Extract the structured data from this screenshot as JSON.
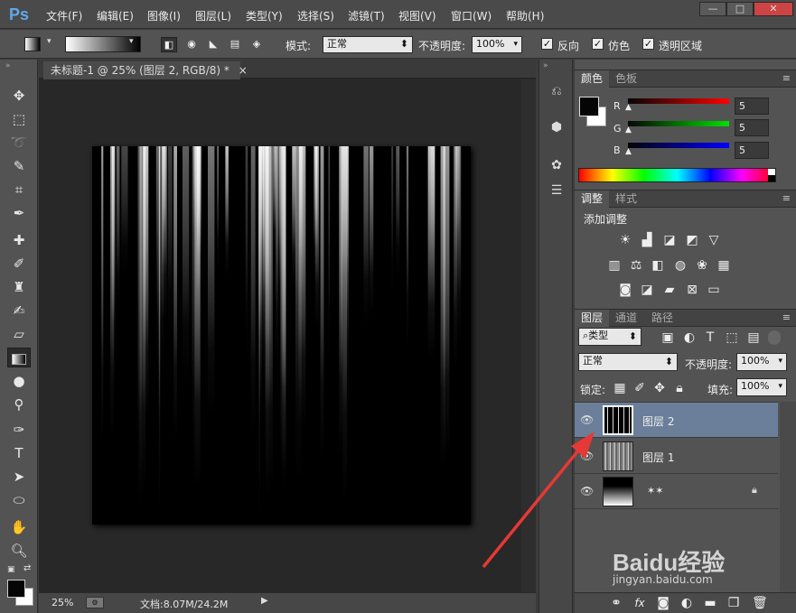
{
  "app": {
    "logo": "Ps",
    "window_buttons": {
      "min": "—",
      "max": "□",
      "close": "✕"
    }
  },
  "menu": [
    "文件(F)",
    "编辑(E)",
    "图像(I)",
    "图层(L)",
    "类型(Y)",
    "选择(S)",
    "滤镜(T)",
    "视图(V)",
    "窗口(W)",
    "帮助(H)"
  ],
  "options": {
    "mode_label": "模式:",
    "mode_value": "正常",
    "opacity_label": "不透明度:",
    "opacity_value": "100%",
    "reverse_label": "反向",
    "dither_label": "仿色",
    "transparency_label": "透明区域"
  },
  "document": {
    "tab_title": "未标题-1 @ 25% (图层 2, RGB/8) *",
    "close": "×",
    "zoom": "25%",
    "doc_info": "文档:8.07M/24.2M"
  },
  "color_panel": {
    "tabs": [
      "颜色",
      "色板"
    ],
    "r_label": "R",
    "g_label": "G",
    "b_label": "B",
    "r": "5",
    "g": "5",
    "b": "5"
  },
  "adjust_panel": {
    "tabs": [
      "调整",
      "样式"
    ],
    "title": "添加调整"
  },
  "layers_panel": {
    "tabs": [
      "图层",
      "通道",
      "路径"
    ],
    "filter_label": "类型",
    "blend_mode": "正常",
    "opacity_label": "不透明度:",
    "opacity_value": "100%",
    "lock_label": "锁定:",
    "fill_label": "填充:",
    "fill_value": "100%",
    "layers": [
      {
        "name": "图层 2",
        "selected": true
      },
      {
        "name": "图层 1",
        "selected": false
      },
      {
        "name": "",
        "selected": false,
        "locked": true
      }
    ]
  },
  "watermark": {
    "brand": "Baidu经验",
    "url": "jingyan.baidu.com"
  },
  "colors": {
    "accent": "#5fa8e8",
    "selected_layer": "#6b7f9a",
    "arrow": "#e53935"
  }
}
